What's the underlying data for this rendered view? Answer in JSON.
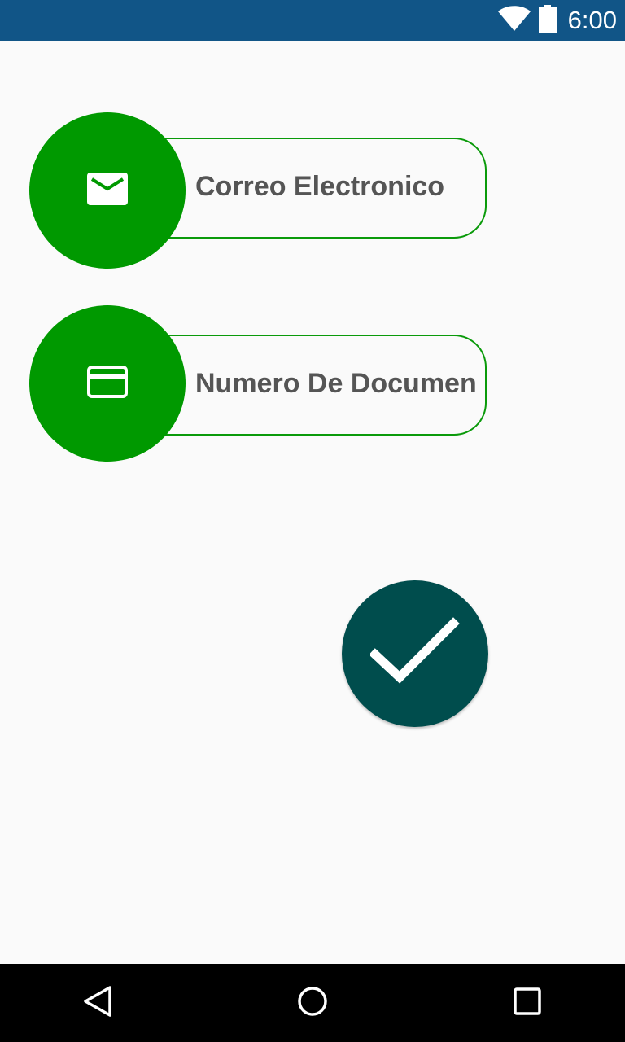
{
  "status_bar": {
    "time": "6:00",
    "icons": [
      "wifi-icon",
      "battery-icon"
    ],
    "background": "#115587"
  },
  "fields": [
    {
      "label": "Correo Electronico",
      "icon": "mail-icon"
    },
    {
      "label": "Numero De Documen",
      "icon": "credit-card-icon"
    }
  ],
  "confirm_button": {
    "icon": "check-icon",
    "color": "#004d4d"
  },
  "accent_color": "#009900",
  "nav_bar": {
    "buttons": [
      "back-icon",
      "home-icon",
      "recents-icon"
    ]
  }
}
